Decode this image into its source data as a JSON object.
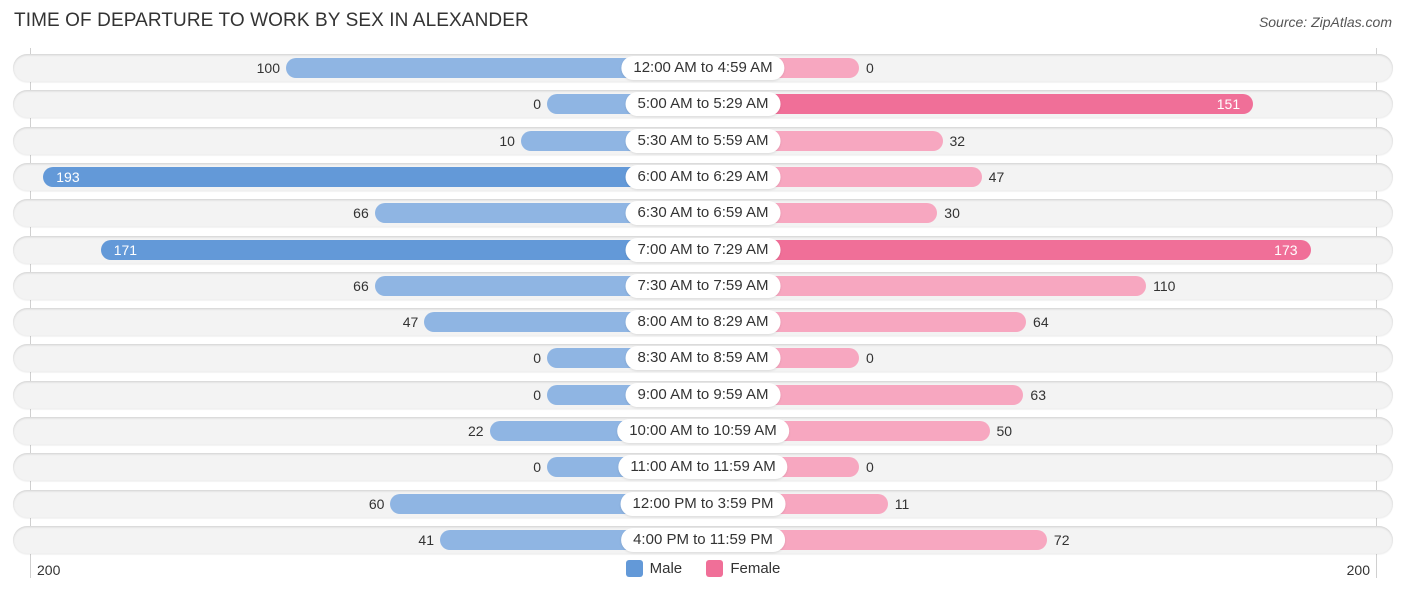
{
  "header": {
    "title": "TIME OF DEPARTURE TO WORK BY SEX IN ALEXANDER",
    "source": "Source: ZipAtlas.com"
  },
  "colors": {
    "male": "#8fb5e3",
    "male_strong": "#6399d8",
    "female": "#f7a7c0",
    "female_strong": "#f06f98"
  },
  "chart_data": {
    "type": "bar",
    "orientation": "horizontal-diverging",
    "title": "TIME OF DEPARTURE TO WORK BY SEX IN ALEXANDER",
    "categories": [
      "12:00 AM to 4:59 AM",
      "5:00 AM to 5:29 AM",
      "5:30 AM to 5:59 AM",
      "6:00 AM to 6:29 AM",
      "6:30 AM to 6:59 AM",
      "7:00 AM to 7:29 AM",
      "7:30 AM to 7:59 AM",
      "8:00 AM to 8:29 AM",
      "8:30 AM to 8:59 AM",
      "9:00 AM to 9:59 AM",
      "10:00 AM to 10:59 AM",
      "11:00 AM to 11:59 AM",
      "12:00 PM to 3:59 PM",
      "4:00 PM to 11:59 PM"
    ],
    "series": [
      {
        "name": "Male",
        "values": [
          100,
          0,
          10,
          193,
          66,
          171,
          66,
          47,
          0,
          0,
          22,
          0,
          60,
          41
        ]
      },
      {
        "name": "Female",
        "values": [
          0,
          151,
          32,
          47,
          30,
          173,
          110,
          64,
          0,
          63,
          50,
          0,
          11,
          72
        ]
      }
    ],
    "axis": {
      "left_tick": "200",
      "right_tick": "200",
      "range": [
        0,
        200
      ]
    },
    "legend": {
      "position": "bottom-center",
      "entries": [
        "Male",
        "Female"
      ]
    },
    "grid": false
  }
}
